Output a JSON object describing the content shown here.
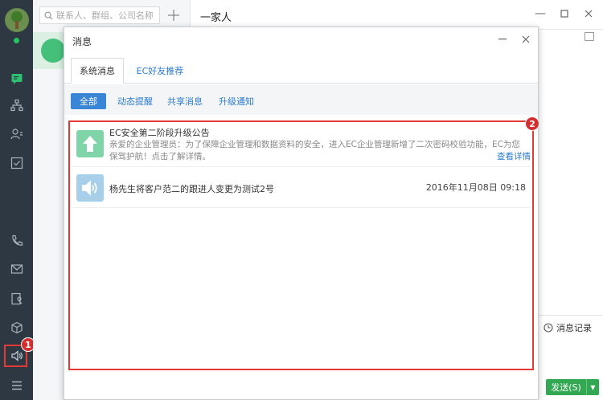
{
  "search": {
    "placeholder": "联系人、群组、公司名称"
  },
  "chat": {
    "title": "一家人",
    "history_label": "消息记录",
    "send_label": "发送(S)"
  },
  "dialog": {
    "title": "消息",
    "tabs": [
      {
        "label": "系统消息"
      },
      {
        "label": "EC好友推荐"
      }
    ],
    "filters": [
      {
        "label": "全部"
      },
      {
        "label": "动态提醒"
      },
      {
        "label": "共享消息"
      },
      {
        "label": "升级通知"
      }
    ],
    "messages": [
      {
        "title": "EC安全第二阶段升级公告",
        "body": "亲爱的企业管理员：为了保障企业管理和数据资料的安全，进入EC企业管理新增了二次密码校验功能，EC为您保驾护航！点击了解详情。",
        "link": "查看详情",
        "icon": "arrow-up-icon"
      },
      {
        "title": "杨先生将客户范二的跟进人变更为测试2号",
        "time": "2016年11月08日 09:18",
        "icon": "speaker-icon"
      }
    ]
  },
  "annotations": {
    "badge1": "1",
    "badge2": "2"
  },
  "colors": {
    "sidebar": "#2d3843",
    "accent": "#3a86d6",
    "highlight": "#e53935",
    "send": "#32a852"
  }
}
